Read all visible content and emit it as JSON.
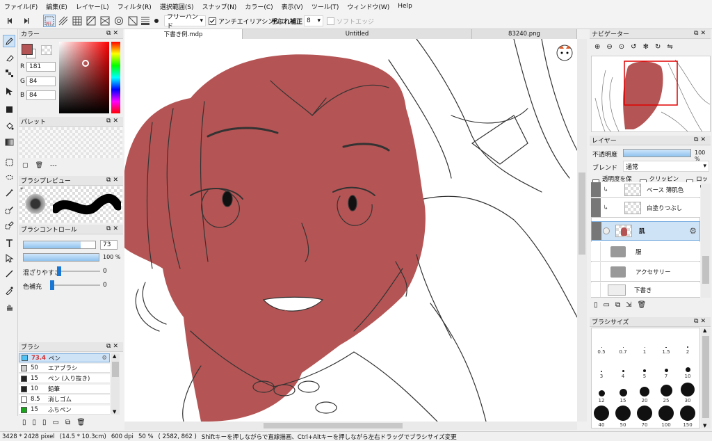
{
  "menu": [
    "ファイル(F)",
    "編集(E)",
    "レイヤー(L)",
    "フィルタ(R)",
    "選択範囲(S)",
    "スナップ(N)",
    "カラー(C)",
    "表示(V)",
    "ツール(T)",
    "ウィンドウ(W)",
    "Help"
  ],
  "toolbar": {
    "mode_off": "OFF",
    "snap_mode": "フリーハンド",
    "antialias": "アンチエイリアシング",
    "stabilizer_label": "手ぶれ補正",
    "stabilizer_value": "8",
    "soft_edge": "ソフトエッジ"
  },
  "color_panel": {
    "title": "カラー",
    "r_label": "R",
    "r": "181",
    "g_label": "G",
    "g": "84",
    "b_label": "B",
    "b": "84",
    "primary": "#b55454"
  },
  "palette_panel": {
    "title": "パレット",
    "dashes": "---"
  },
  "brush_preview": {
    "title": "ブラシプレビュー",
    "star": "*"
  },
  "brush_control": {
    "title": "ブラシコントロール",
    "size": "73",
    "opacity": "100 %",
    "blend_label": "混ざりやすさ",
    "blend_value": "0",
    "color_extend_label": "色補充",
    "color_extend_value": "0"
  },
  "brush_panel": {
    "title": "ブラシ",
    "items": [
      {
        "size": "73.4",
        "name": "ペン",
        "color": "#4fc3f7",
        "selected": true
      },
      {
        "size": "50",
        "name": "エアブラシ",
        "color": "#cfcfcf"
      },
      {
        "size": "15",
        "name": "ペン (入り抜き)",
        "color": "#222222"
      },
      {
        "size": "10",
        "name": "鉛筆",
        "color": "#222222"
      },
      {
        "size": "8.5",
        "name": "消しゴム",
        "color": "#ffffff"
      },
      {
        "size": "15",
        "name": "ふちペン",
        "color": "#1aa61a"
      }
    ]
  },
  "tabs": [
    {
      "label": "下書き例.mdp",
      "active": true
    },
    {
      "label": "Untitled",
      "active": false
    },
    {
      "label": "83240.png",
      "active": false
    }
  ],
  "navigator": {
    "title": "ナビゲーター"
  },
  "layer_panel": {
    "title": "レイヤー",
    "opacity_label": "不透明度",
    "opacity_value": "100 %",
    "blend_label": "ブレンド",
    "blend_value": "通常",
    "protect_alpha": "透明度を保護",
    "clipping": "クリッピング",
    "lock": "ロック",
    "layers": [
      {
        "name": "ベース 薄肌色"
      },
      {
        "name": "白塗りつぶし"
      },
      {
        "name": "肌"
      },
      {
        "name": "服"
      },
      {
        "name": "アクセサリー"
      },
      {
        "name": "下書き"
      }
    ]
  },
  "brush_size_panel": {
    "title": "ブラシサイズ",
    "sizes": [
      "0.5",
      "0.7",
      "1",
      "1.5",
      "2",
      "3",
      "4",
      "5",
      "7",
      "10",
      "12",
      "15",
      "20",
      "25",
      "30",
      "40",
      "50",
      "70",
      "100",
      "150"
    ]
  },
  "status": {
    "size": "3428 * 2428 pixel",
    "cm": "(14.5 * 10.3cm)",
    "dpi": "600 dpi",
    "zoom": "50 %",
    "coords": "( 2582, 862 )",
    "hint": "Shiftキーを押しながらで直線描画、Ctrl+Altキーを押しながら左右ドラッグでブラシサイズ変更"
  }
}
